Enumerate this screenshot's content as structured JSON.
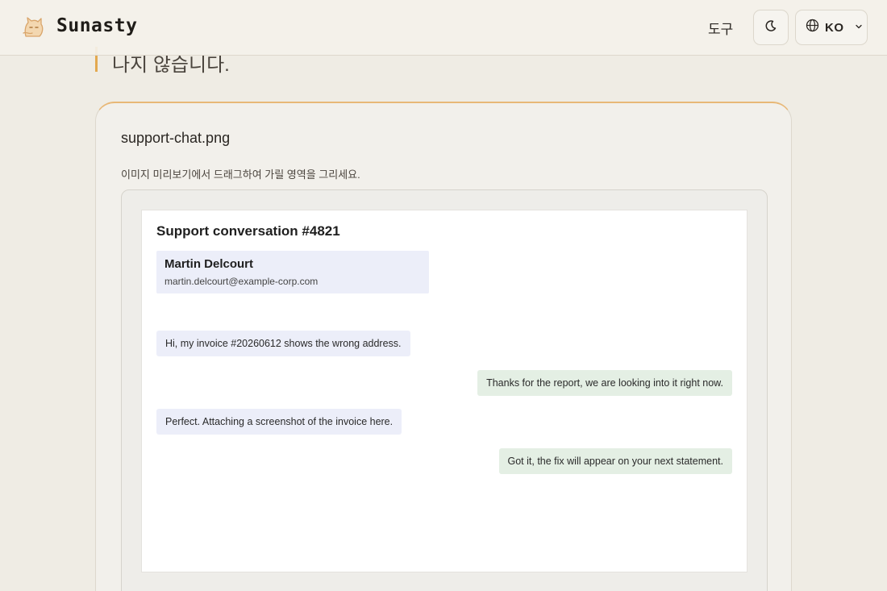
{
  "header": {
    "brand": "Sunasty",
    "tools_label": "도구",
    "lang_label": "KO",
    "icons": {
      "logo": "cat-logo-icon",
      "theme": "moon-icon",
      "lang": "globe-icon",
      "dropdown": "chevron-down-icon"
    }
  },
  "intro": {
    "text_fragment": "나지 않습니다."
  },
  "card": {
    "file_name": "support-chat.png",
    "hint": "이미지 미리보기에서 드래그하여 가릴 영역을 그리세요."
  },
  "preview": {
    "title": "Support conversation #4821",
    "contact_name": "Martin Delcourt",
    "contact_email": "martin.delcourt@example-corp.com",
    "messages": [
      {
        "side": "in",
        "text": "Hi, my invoice #20260612 shows the wrong address."
      },
      {
        "side": "out",
        "text": "Thanks for the report, we are looking into it right now."
      },
      {
        "side": "in",
        "text": "Perfect. Attaching a screenshot of the invoice here."
      },
      {
        "side": "out",
        "text": "Got it, the fix will appear on your next statement."
      }
    ]
  },
  "colors": {
    "accent": "#e3a94f",
    "background": "#efece4"
  }
}
